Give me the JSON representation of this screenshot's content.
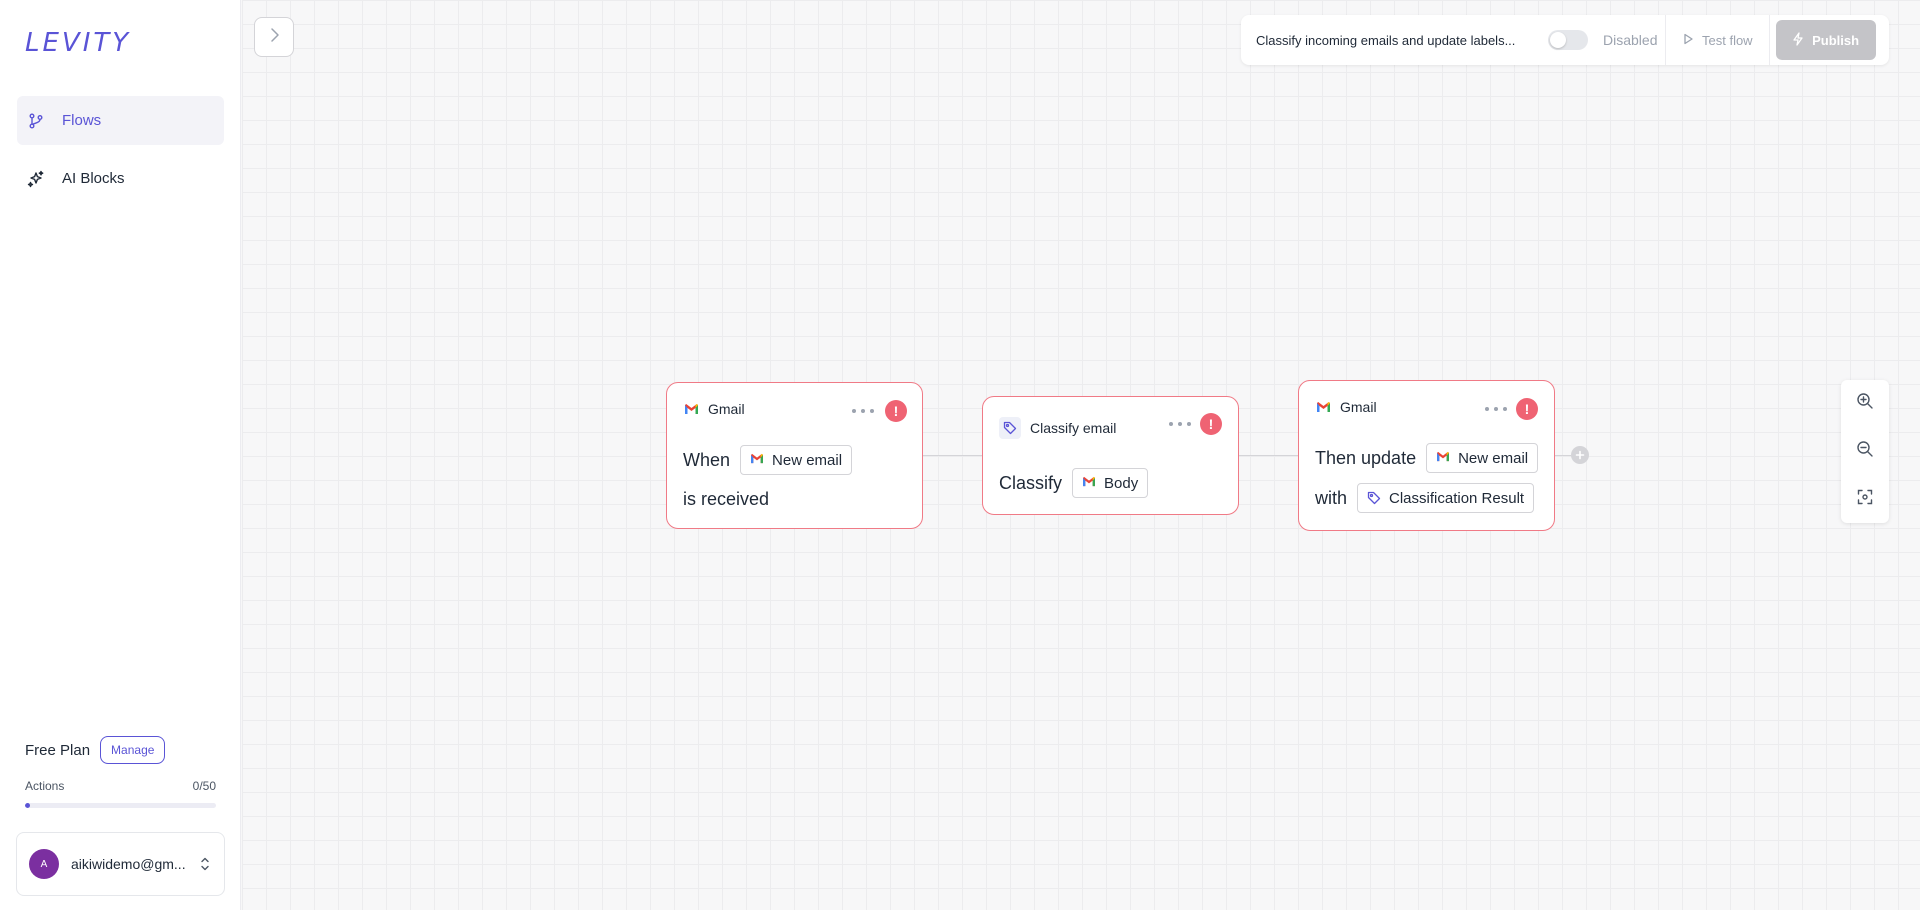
{
  "sidebar": {
    "logo": "LEVITY",
    "items": [
      {
        "label": "Flows",
        "icon": "git-branch-icon",
        "active": true
      },
      {
        "label": "AI Blocks",
        "icon": "sparkles-icon",
        "active": false
      }
    ],
    "plan": {
      "label": "Free Plan",
      "manage_label": "Manage",
      "actions_label": "Actions",
      "actions_count": "0/50",
      "actions_used": 0,
      "actions_total": 50
    },
    "user": {
      "avatar_initial": "A",
      "email": "aikiwidemo@gm..."
    }
  },
  "topbar": {
    "flow_title": "Classify incoming emails and update labels...",
    "toggle_label": "Disabled",
    "test_label": "Test flow",
    "publish_label": "Publish"
  },
  "nodes": [
    {
      "app": "Gmail",
      "line1_prefix": "When",
      "line1_chip": "New email",
      "line2": "is received"
    },
    {
      "app": "Classify email",
      "line1_prefix": "Classify",
      "line1_chip": "Body"
    },
    {
      "app": "Gmail",
      "line1_prefix": "Then update",
      "line1_chip": "New email",
      "line2_prefix": "with",
      "line2_chip": "Classification Result"
    }
  ],
  "colors": {
    "accent": "#5a54d6",
    "error": "#ef6373",
    "node_border": "#f07a86",
    "avatar": "#7b2fa0"
  }
}
